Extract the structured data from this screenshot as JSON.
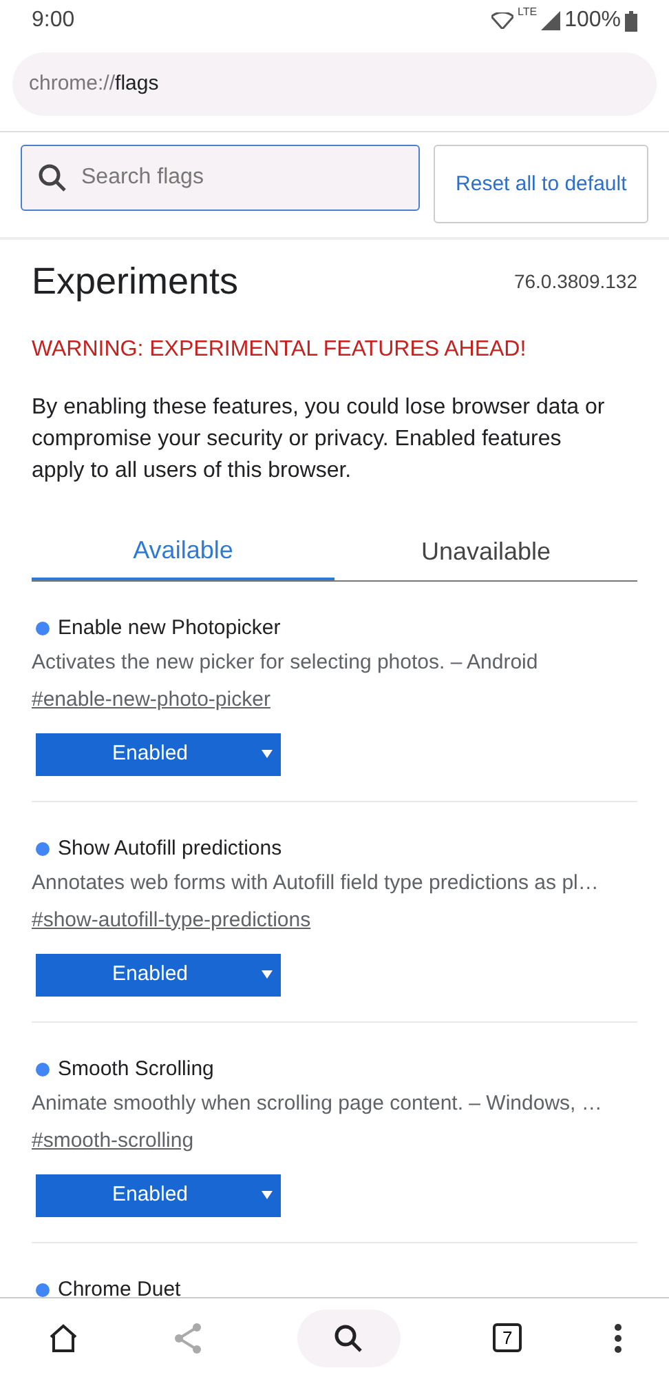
{
  "status_bar": {
    "time": "9:00",
    "network": "LTE",
    "battery": "100%"
  },
  "address_bar": {
    "scheme": "chrome://",
    "host": "flags"
  },
  "search": {
    "placeholder": "Search flags"
  },
  "reset_button": "Reset all to default",
  "header": {
    "title": "Experiments",
    "version": "76.0.3809.132"
  },
  "warning": "WARNING: EXPERIMENTAL FEATURES AHEAD!",
  "intro": "By enabling these features, you could lose browser data or compromise your security or privacy. Enabled features apply to all users of this browser.",
  "tabs": [
    {
      "label": "Available",
      "selected": true
    },
    {
      "label": "Unavailable",
      "selected": false
    }
  ],
  "flags": [
    {
      "name": "Enable new Photopicker",
      "modified": true,
      "description": "Activates the new picker for selecting photos. – Android",
      "link": "#enable-new-photo-picker",
      "value": "Enabled"
    },
    {
      "name": "Show Autofill predictions",
      "modified": true,
      "description": "Annotates web forms with Autofill field type predictions as pl…",
      "link": "#show-autofill-type-predictions",
      "value": "Enabled"
    },
    {
      "name": "Smooth Scrolling",
      "modified": true,
      "description": "Animate smoothly when scrolling page content. – Windows, …",
      "link": "#smooth-scrolling",
      "value": "Enabled"
    },
    {
      "name": "Chrome Duet",
      "modified": true
    }
  ],
  "bottom_bar": {
    "tab_count": "7"
  }
}
